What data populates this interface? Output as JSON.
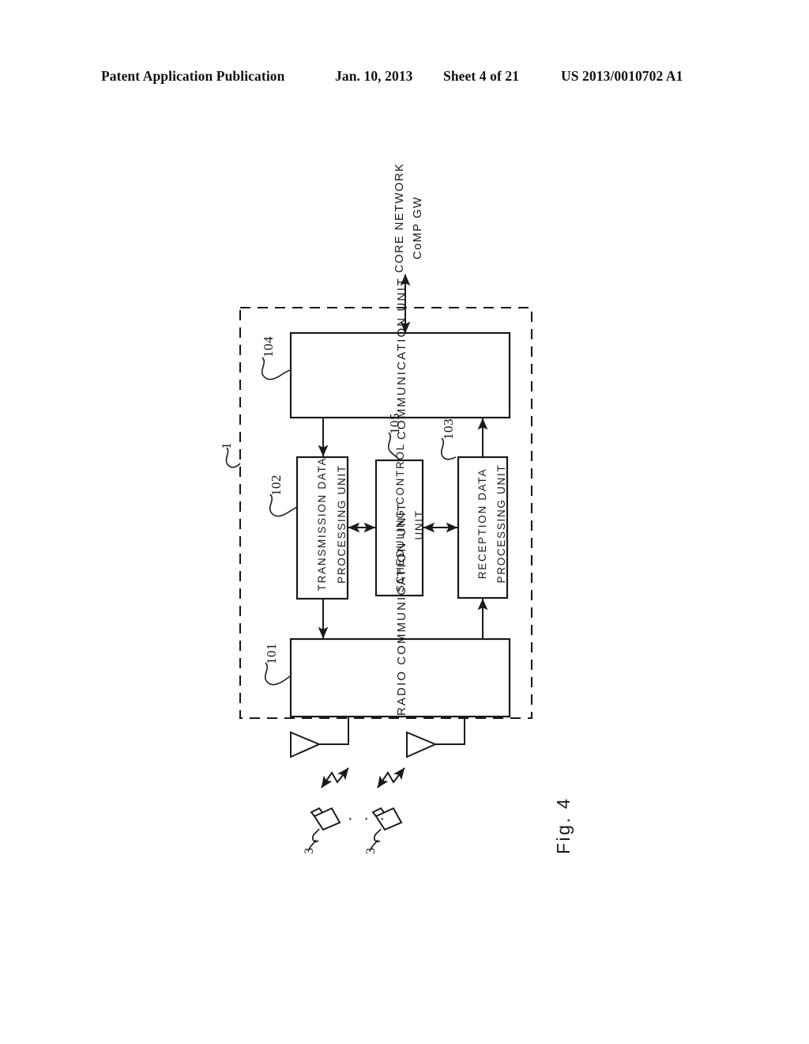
{
  "header": {
    "publication": "Patent Application Publication",
    "date": "Jan. 10, 2013",
    "sheet": "Sheet 4 of 21",
    "patent_number": "US 2013/0010702 A1"
  },
  "figure": {
    "caption": "Fig. 4",
    "external_network": {
      "line1": "CORE NETWORK",
      "line2": "CoMP GW"
    },
    "apparatus_ref": "1",
    "blocks": [
      {
        "id": "communication-unit",
        "label": "COMMUNICATION UNIT",
        "ref": "104"
      },
      {
        "id": "transmission-data-processing-unit",
        "label_line1": "TRANSMISSION DATA",
        "label_line2": "PROCESSING UNIT",
        "ref": "102"
      },
      {
        "id": "scheduling-control-unit",
        "label_line1": "SCHEDULING CONTROL",
        "label_line2": "UNIT",
        "ref": "105"
      },
      {
        "id": "reception-data-processing-unit",
        "label_line1": "RECEPTION DATA",
        "label_line2": "PROCESSING UNIT",
        "ref": "103"
      },
      {
        "id": "radio-communication-unit",
        "label": "RADIO COMMUNICATION UNIT",
        "ref": "101"
      }
    ],
    "terminals": [
      {
        "ref": "3"
      },
      {
        "ref": "3"
      }
    ],
    "terminal_ellipsis": "· · ·",
    "colors": {
      "ink": "#1a1a1a",
      "paper": "#ffffff"
    }
  }
}
